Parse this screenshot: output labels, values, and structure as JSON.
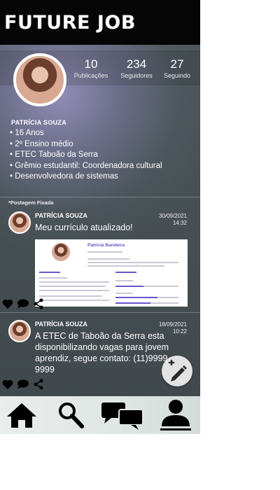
{
  "app": {
    "logo": "FUTURE JOB"
  },
  "profile": {
    "stats": [
      {
        "value": "10",
        "label": "Publicações"
      },
      {
        "value": "234",
        "label": "Seguidores"
      },
      {
        "value": "27",
        "label": "Seguindo"
      }
    ],
    "name": "PATRÍCIA SOUZA",
    "bio": [
      "16 Anos",
      "2º Ensino médio",
      "ETEC Taboão da Serra",
      "Grêmio estudantil: Coordenadora cultural",
      "Desenvolvedora de sistemas"
    ]
  },
  "pinned_label": "*Postagem Fixada",
  "posts": [
    {
      "author": "PATRÍCIA SOUZA",
      "date": "30/09/2021",
      "time": "14:32",
      "text": "Meu currículo atualizado!",
      "attachment": {
        "name": "Patricia Bandeira"
      }
    },
    {
      "author": "PATRÍCIA SOUZA",
      "date": "18/09/2021",
      "time": "10:22",
      "text": "A ETEC de Taboão da Serra esta disponibilizando vagas para jovem aprendiz, segue contato: (11)9999-9999"
    }
  ],
  "icons": {
    "post_actions": [
      "heart-icon",
      "comment-icon",
      "share-icon"
    ],
    "fab": "compose-icon",
    "nav": [
      "home-icon",
      "search-icon",
      "chat-icon",
      "profile-icon"
    ]
  }
}
